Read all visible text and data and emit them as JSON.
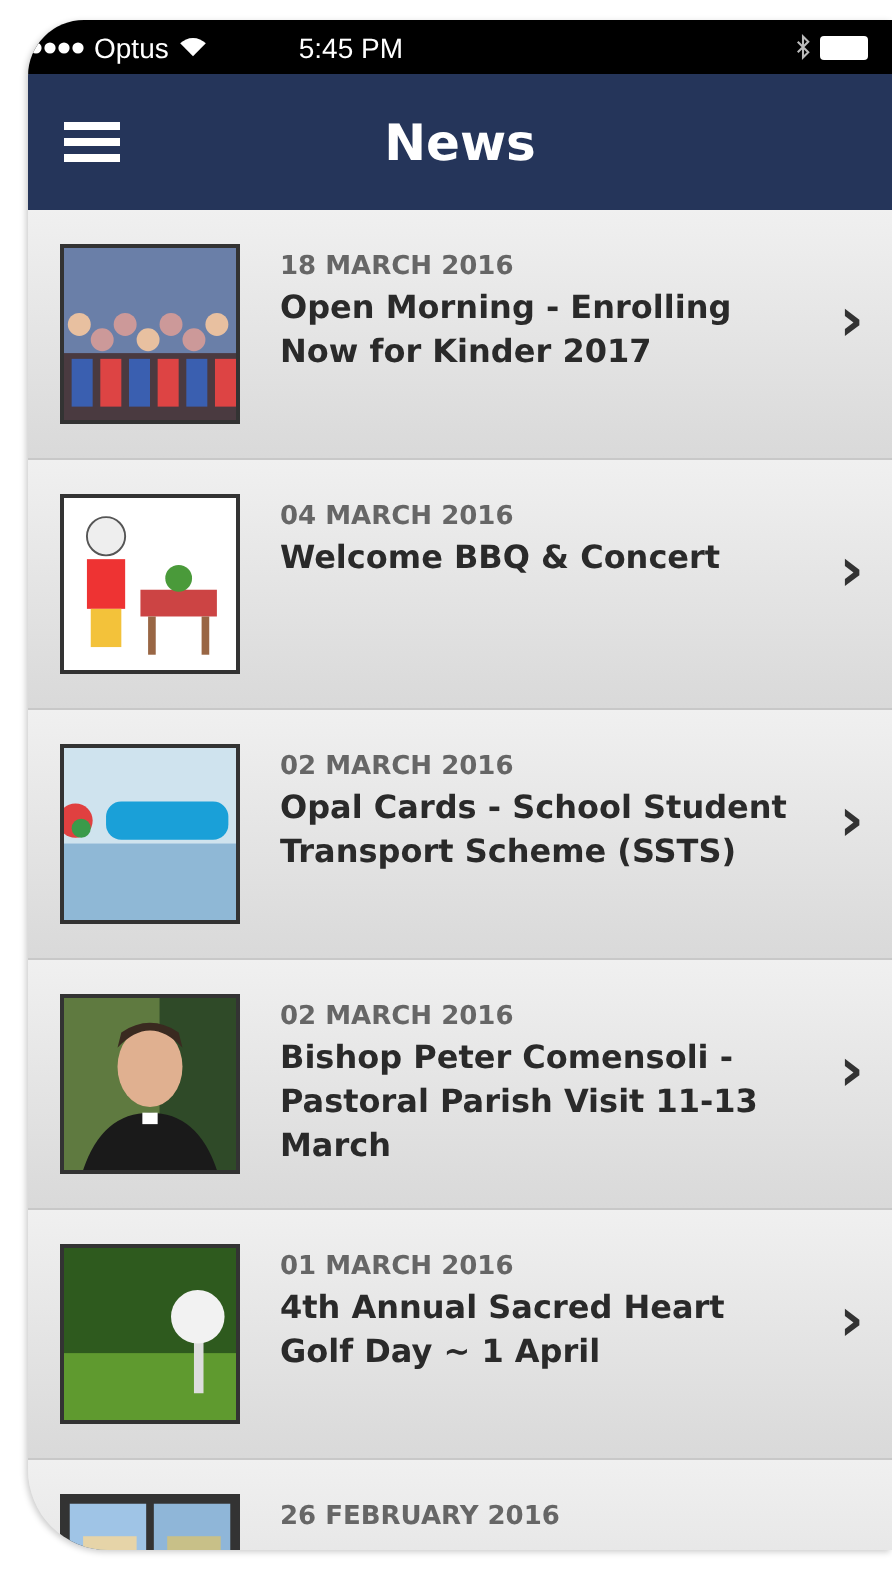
{
  "status_bar": {
    "carrier": "Optus",
    "time": "5:45 PM"
  },
  "nav_bar": {
    "title": "News"
  },
  "news": [
    {
      "date": "18 MARCH 2016",
      "title": "Open Morning - Enrolling Now for Kinder 2017",
      "chevron": "›",
      "kind": "picture"
    },
    {
      "date": "04 MARCH 2016",
      "title": "Welcome BBQ & Concert",
      "chevron": "›",
      "kind": "picture"
    },
    {
      "date": "02 MARCH 2016",
      "title": "Opal Cards - School Student Transport Scheme (SSTS)",
      "chevron": "›",
      "kind": "picture"
    },
    {
      "date": "02 MARCH 2016",
      "title": "Bishop Peter Comensoli - Pastoral Parish Visit 11-13 March",
      "chevron": "›",
      "kind": "picture"
    },
    {
      "date": "01 MARCH 2016",
      "title": "4th Annual Sacred Heart Golf Day ~ 1 April",
      "chevron": "›",
      "kind": "picture"
    },
    {
      "date": "26 FEBRUARY 2016",
      "kind": "picture"
    }
  ]
}
